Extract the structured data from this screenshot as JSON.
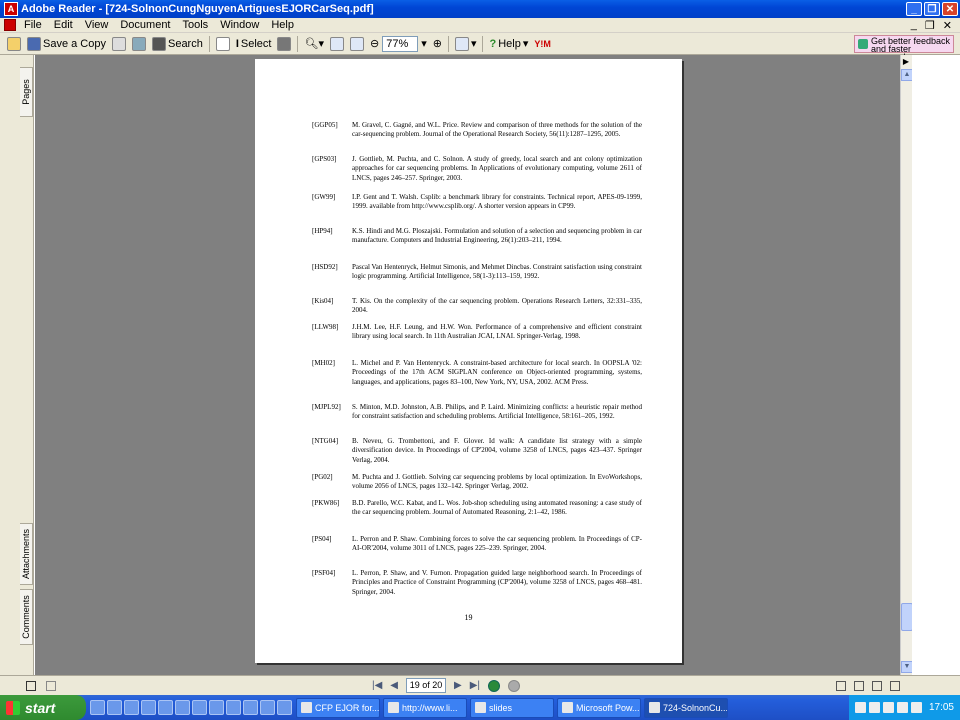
{
  "window": {
    "title": "Adobe Reader - [724-SolnonCungNguyenArtiguesEJORCarSeq.pdf]",
    "app_icon_label": "A"
  },
  "menu": [
    "File",
    "Edit",
    "View",
    "Document",
    "Tools",
    "Window",
    "Help"
  ],
  "menu_right": [
    "_",
    "❒",
    "✕"
  ],
  "toolbar": {
    "save_copy": "Save a Copy",
    "search": "Search",
    "select": "Select",
    "zoom": "77%",
    "help": "Help",
    "feedback": "Get better feedback and faster approvals"
  },
  "nav_tabs": [
    "Pages",
    "Attachments",
    "Comments"
  ],
  "page": {
    "number": "19",
    "references": [
      {
        "key": "[GGP05]",
        "text": "M. Gravel, C. Gagné, and W.L. Price. Review and comparison of three methods for the solution of the car-sequencing problem. Journal of the Operational Research Society, 56(11):1287–1295, 2005."
      },
      {
        "key": "[GPS03]",
        "text": "J. Gottlieb, M. Puchta, and C. Solnon. A study of greedy, local search and ant colony optimization approaches for car sequencing problems. In Applications of evolutionary computing, volume 2611 of LNCS, pages 246–257. Springer, 2003."
      },
      {
        "key": "[GW99]",
        "text": "I.P. Gent and T. Walsh. Csplib: a benchmark library for constraints. Technical report, APES-09-1999, 1999. available from http://www.csplib.org/. A shorter version appears in CP99."
      },
      {
        "key": "[HP94]",
        "text": "K.S. Hindi and M.G. Ploszajski. Formulation and solution of a selection and sequencing problem in car manufacture. Computers and Industrial Engineering, 26(1):203–211, 1994."
      },
      {
        "key": "[HSD92]",
        "text": "Pascal Van Hentenryck, Helmut Simonis, and Mehmet Dincbas. Constraint satisfaction using constraint logic programming. Artificial Intelligence, 58(1-3):113–159, 1992."
      },
      {
        "key": "[Kis04]",
        "text": "T. Kis. On the complexity of the car sequencing problem. Operations Research Letters, 32:331–335, 2004."
      },
      {
        "key": "[LLW98]",
        "text": "J.H.M. Lee, H.F. Leung, and H.W. Won. Performance of a comprehensive and efficient constraint library using local search. In 11th Australian JCAI, LNAI. Springer-Verlag, 1998."
      },
      {
        "key": "[MH02]",
        "text": "L. Michel and P. Van Hentenryck. A constraint-based architecture for local search. In OOPSLA '02: Proceedings of the 17th ACM SIGPLAN conference on Object-oriented programming, systems, languages, and applications, pages 83–100, New York, NY, USA, 2002. ACM Press."
      },
      {
        "key": "[MJPL92]",
        "text": "S. Minton, M.D. Johnston, A.B. Philips, and P. Laird. Minimizing conflicts: a heuristic repair method for constraint satisfaction and scheduling problems. Artificial Intelligence, 58:161–205, 1992."
      },
      {
        "key": "[NTG04]",
        "text": "B. Neveu, G. Trombettoni, and F. Glover. Id walk: A candidate list strategy with a simple diversification device. In Proceedings of CP'2004, volume 3258 of LNCS, pages 423–437. Springer Verlag, 2004."
      },
      {
        "key": "[PG02]",
        "text": "M. Puchta and J. Gottlieb. Solving car sequencing problems by local optimization. In EvoWorkshops, volume 2056 of LNCS, pages 132–142. Springer Verlag, 2002."
      },
      {
        "key": "[PKW86]",
        "text": "B.D. Parello, W.C. Kabat, and L. Wos. Job-shop scheduling using automated reasoning: a case study of the car sequencing problem. Journal of Automated Reasoning, 2:1–42, 1986."
      },
      {
        "key": "[PS04]",
        "text": "L. Perron and P. Shaw. Combining forces to solve the car sequencing problem. In Proceedings of CP-AI-OR'2004, volume 3011 of LNCS, pages 225–239. Springer, 2004."
      },
      {
        "key": "[PSF04]",
        "text": "L. Perron, P. Shaw, and V. Furnon. Propagation guided large neighborhood search. In Proceedings of Principles and Practice of Constraint Programming (CP'2004), volume 3258 of LNCS, pages 468–481. Springer, 2004."
      }
    ]
  },
  "status": {
    "page_indicator": "19 of 20"
  },
  "taskbar": {
    "start": "start",
    "tasks": [
      "CFP EJOR for...",
      "http://www.li...",
      "slides",
      "Microsoft Pow...",
      "724-SolnonCu..."
    ],
    "clock": "17:05"
  }
}
